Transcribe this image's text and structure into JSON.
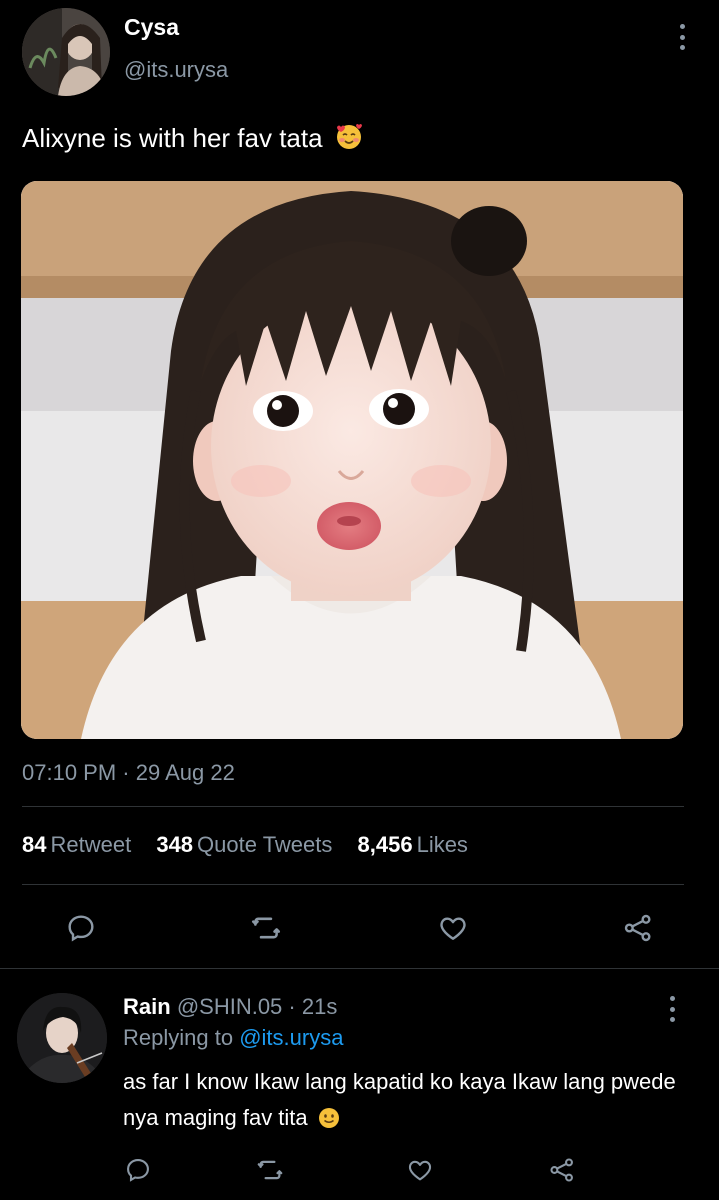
{
  "tweet": {
    "author": {
      "name": "Cysa",
      "handle": "@its.urysa"
    },
    "text": "Alixyne is with her fav tata",
    "text_emoji": "smiling-face-with-hearts-icon",
    "image": {
      "alt": "Photo of a young girl with bangs making a pouting face"
    },
    "timestamp": "07:10 PM · 29 Aug 22",
    "stats": [
      {
        "count": "84",
        "label": "Retweet"
      },
      {
        "count": "348",
        "label": "Quote Tweets"
      },
      {
        "count": "8,456",
        "label": "Likes"
      }
    ],
    "actions": [
      "reply-icon",
      "retweet-icon",
      "like-icon",
      "share-icon"
    ]
  },
  "reply": {
    "name": "Rain",
    "handle": "@SHIN.05",
    "separator": " · ",
    "time": "21s",
    "replying_prefix": "Replying to ",
    "replying_to": "@its.urysa",
    "text": "as far I know Ikaw lang kapatid ko kaya Ikaw lang pwede nya maging fav tita",
    "text_emoji": "slightly-smiling-face-icon"
  },
  "colors": {
    "background": "#000000",
    "text": "#ffffff",
    "secondary": "#8b98a5",
    "link": "#1d9bf0",
    "divider": "#2f3336"
  }
}
